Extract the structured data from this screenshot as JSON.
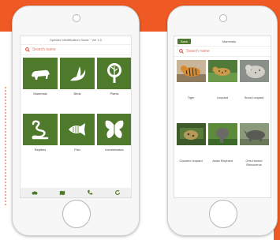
{
  "phone1": {
    "status": "Species Identification Guide · Ver 1.0",
    "search_placeholder": "Search name",
    "categories": [
      {
        "label": "Mammals",
        "icon": "bear-icon"
      },
      {
        "label": "Birds",
        "icon": "bird-icon"
      },
      {
        "label": "Plants",
        "icon": "tree-icon"
      },
      {
        "label": "Reptiles",
        "icon": "snake-icon"
      },
      {
        "label": "Fish",
        "icon": "fish-icon"
      },
      {
        "label": "Invertebrates",
        "icon": "butterfly-icon"
      }
    ],
    "bottom_icons": [
      "binoculars-icon",
      "map-icon",
      "phone-icon",
      "refresh-icon"
    ]
  },
  "phone2": {
    "back_label": "Back",
    "title": "Mammals",
    "search_placeholder": "Search name",
    "animals": [
      {
        "label": "Tiger"
      },
      {
        "label": "Leopard"
      },
      {
        "label": "Snow Leopard"
      },
      {
        "label": "Clouded Leopard"
      },
      {
        "label": "Asian Elephant"
      },
      {
        "label": "One-Horned Rhinoceros"
      }
    ]
  },
  "colors": {
    "brand_orange": "#ef5a24",
    "tile_green": "#4f7a2c",
    "search_red": "#d63a2a"
  }
}
